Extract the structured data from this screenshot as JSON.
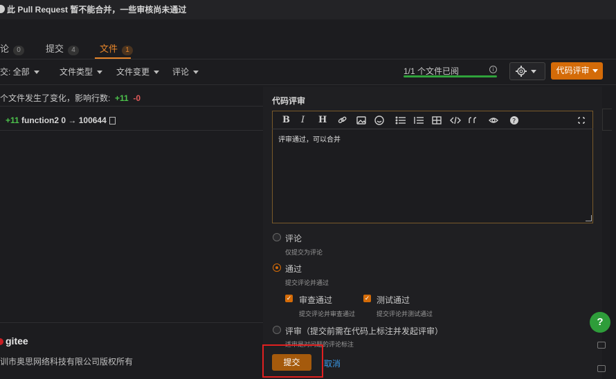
{
  "notice": {
    "text": "此 Pull Request 暂不能合并，一些审核尚未通过"
  },
  "tabs": [
    {
      "label": "论",
      "count": "0"
    },
    {
      "label": "提交",
      "count": "4"
    },
    {
      "label": "文件",
      "count": "1"
    }
  ],
  "filters": [
    {
      "label": "交: 全部"
    },
    {
      "label": "文件类型"
    },
    {
      "label": "文件变更"
    },
    {
      "label": "评论"
    }
  ],
  "reviewed": {
    "text": "1/1 个文件已阅",
    "progress": 1.0
  },
  "review_button": {
    "label": "代码评审"
  },
  "changes": {
    "text": "个文件发生了变化，影响行数:",
    "added": "+11",
    "removed": "-0"
  },
  "file": {
    "added": "+11",
    "name": "function2 0 → 100644"
  },
  "footer": {
    "brand": "gitee",
    "copyright": "训市奥思网络科技有限公司版权所有"
  },
  "panel": {
    "title": "代码评审",
    "editor_text": "评审通过，可以合并",
    "toolbar": [
      "B",
      "I",
      "H"
    ],
    "options": [
      {
        "label": "评论",
        "desc": "仅提交为评论"
      },
      {
        "label": "通过",
        "desc": "提交评论并通过"
      },
      {
        "label": "评审（提交前需在代码上标注并发起评审）",
        "desc": "适审是对问题的评论标注"
      }
    ],
    "sub_checks": [
      {
        "label": "审查通过",
        "desc": "提交评论并审查通过"
      },
      {
        "label": "测试通过",
        "desc": "提交评论并测试通过"
      }
    ],
    "submit_label": "提交",
    "cancel_label": "取消"
  },
  "help": {
    "label": "?"
  },
  "colors": {
    "accent": "#d46b08",
    "success": "#2fa33b",
    "link": "#3a9ae8"
  }
}
